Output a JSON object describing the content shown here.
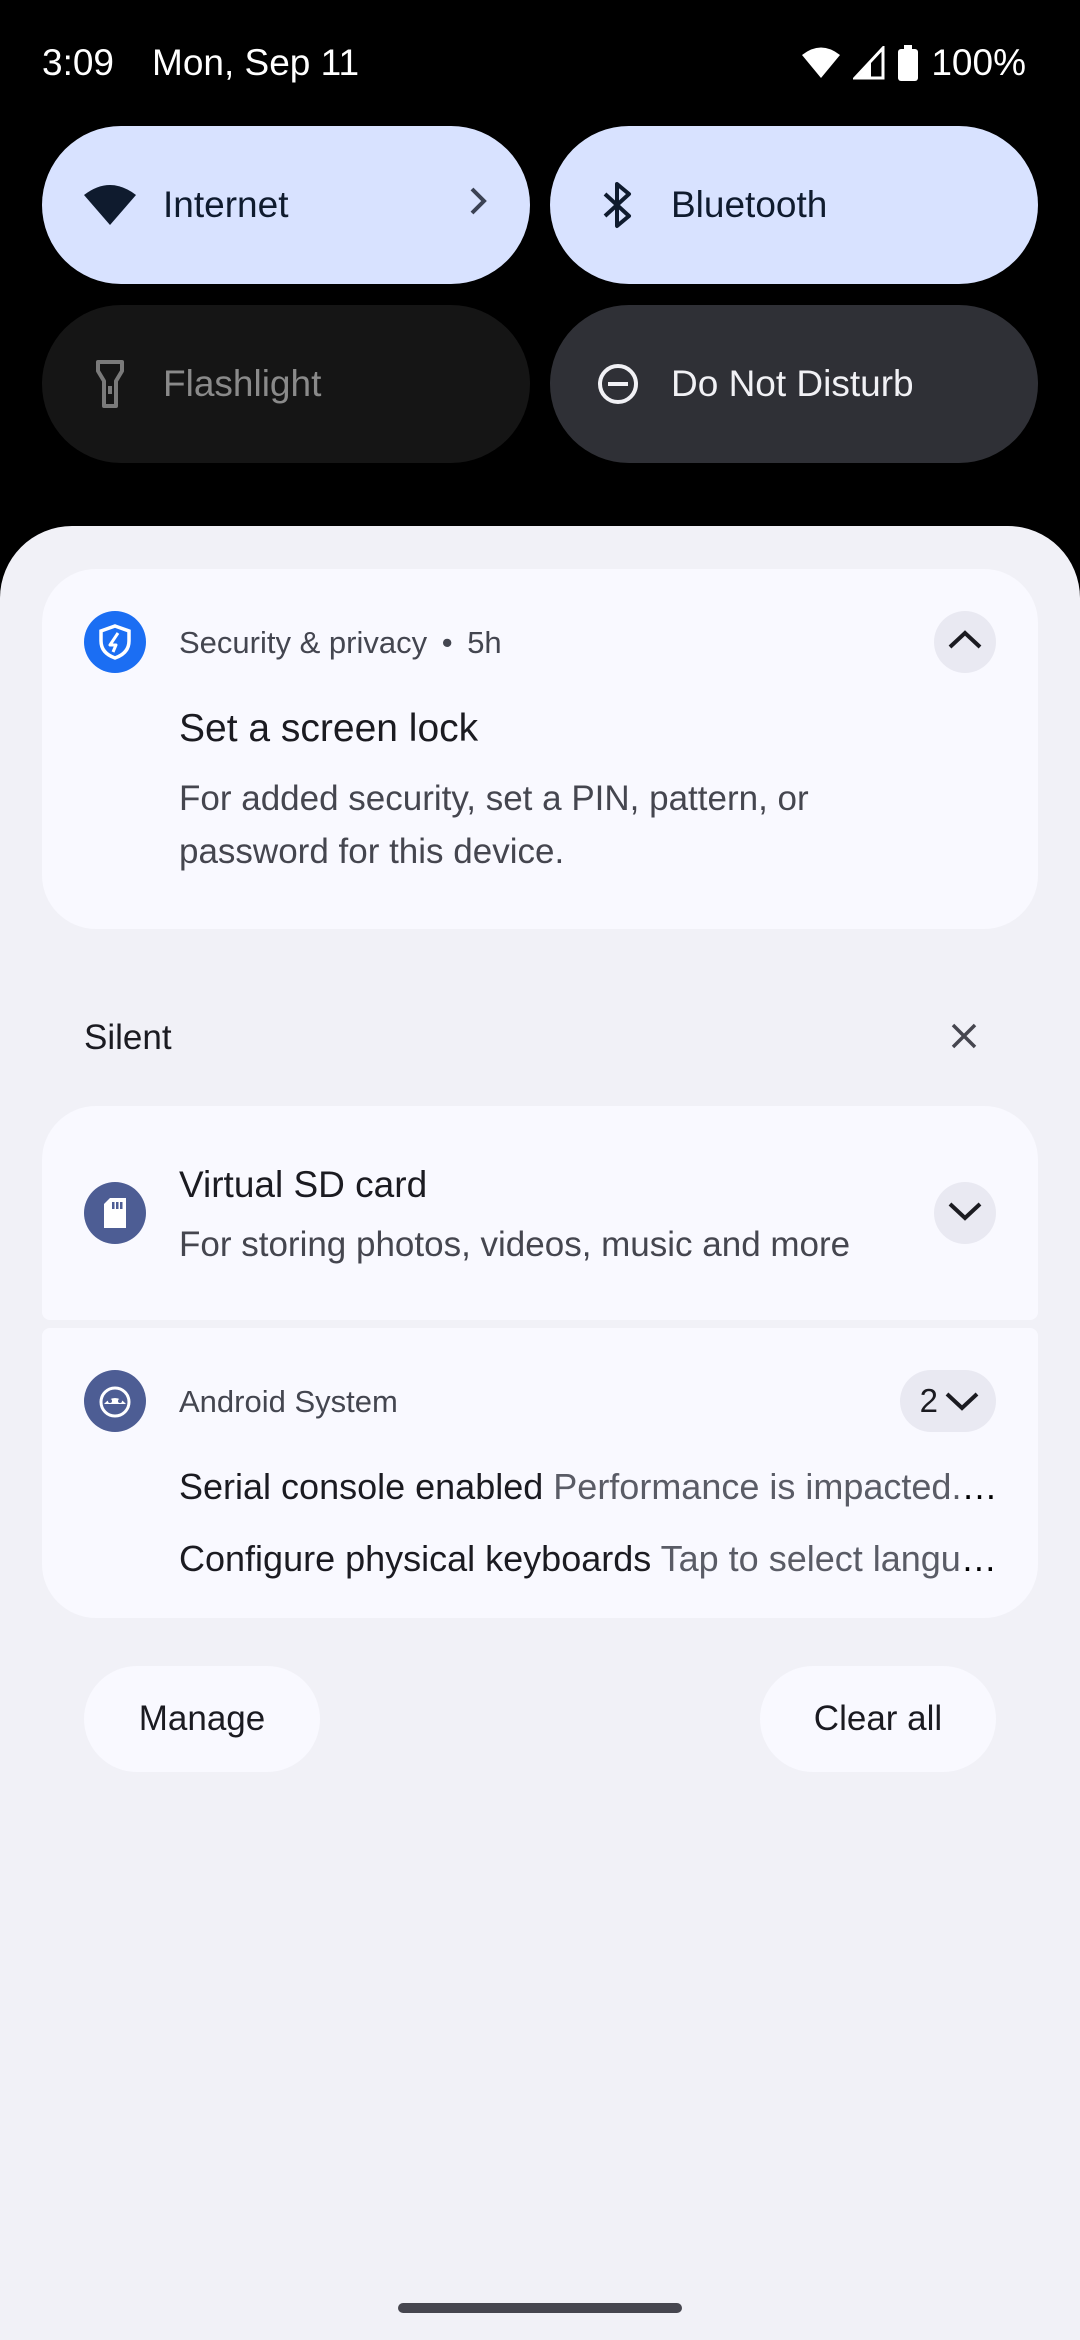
{
  "status_bar": {
    "time": "3:09",
    "date": "Mon, Sep 11",
    "battery": "100%",
    "icons": [
      "wifi-icon",
      "signal-icon",
      "battery-icon"
    ]
  },
  "quick_settings": {
    "tiles": [
      {
        "label": "Internet",
        "icon": "wifi-icon",
        "state": "on",
        "has_chevron": true
      },
      {
        "label": "Bluetooth",
        "icon": "bluetooth-icon",
        "state": "on"
      },
      {
        "label": "Flashlight",
        "icon": "flashlight-icon",
        "state": "unavailable"
      },
      {
        "label": "Do Not Disturb",
        "icon": "do-not-disturb-icon",
        "state": "off"
      }
    ]
  },
  "notifications": {
    "security": {
      "app": "Security & privacy",
      "separator": "•",
      "time": "5h",
      "title": "Set a screen lock",
      "body": "For added security, set a PIN, pattern, or password for this device.",
      "icon": "shield-icon",
      "icon_color": "#1b6ef3"
    },
    "silent_section": {
      "label": "Silent"
    },
    "sd_card": {
      "title": "Virtual SD card",
      "body": "For storing photos, videos, music and more",
      "icon": "sd-card-icon",
      "icon_color": "#4d5d94"
    },
    "android_system": {
      "app": "Android System",
      "count": "2",
      "icon": "android-icon",
      "icon_color": "#4d5d94",
      "rows": [
        {
          "title": "Serial console enabled",
          "text": "Performance is impacted. To disable, check bootloader."
        },
        {
          "title": "Configure physical keyboards",
          "text": "Tap to select language and layout"
        }
      ]
    }
  },
  "footer": {
    "manage_label": "Manage",
    "clear_all_label": "Clear all"
  },
  "colors": {
    "tile_on": "#d8e2ff",
    "tile_off": "#151515",
    "tile_dnd": "#2f3036",
    "shade_bg": "#f1f1f7",
    "card_bg": "#f9f9ff"
  }
}
